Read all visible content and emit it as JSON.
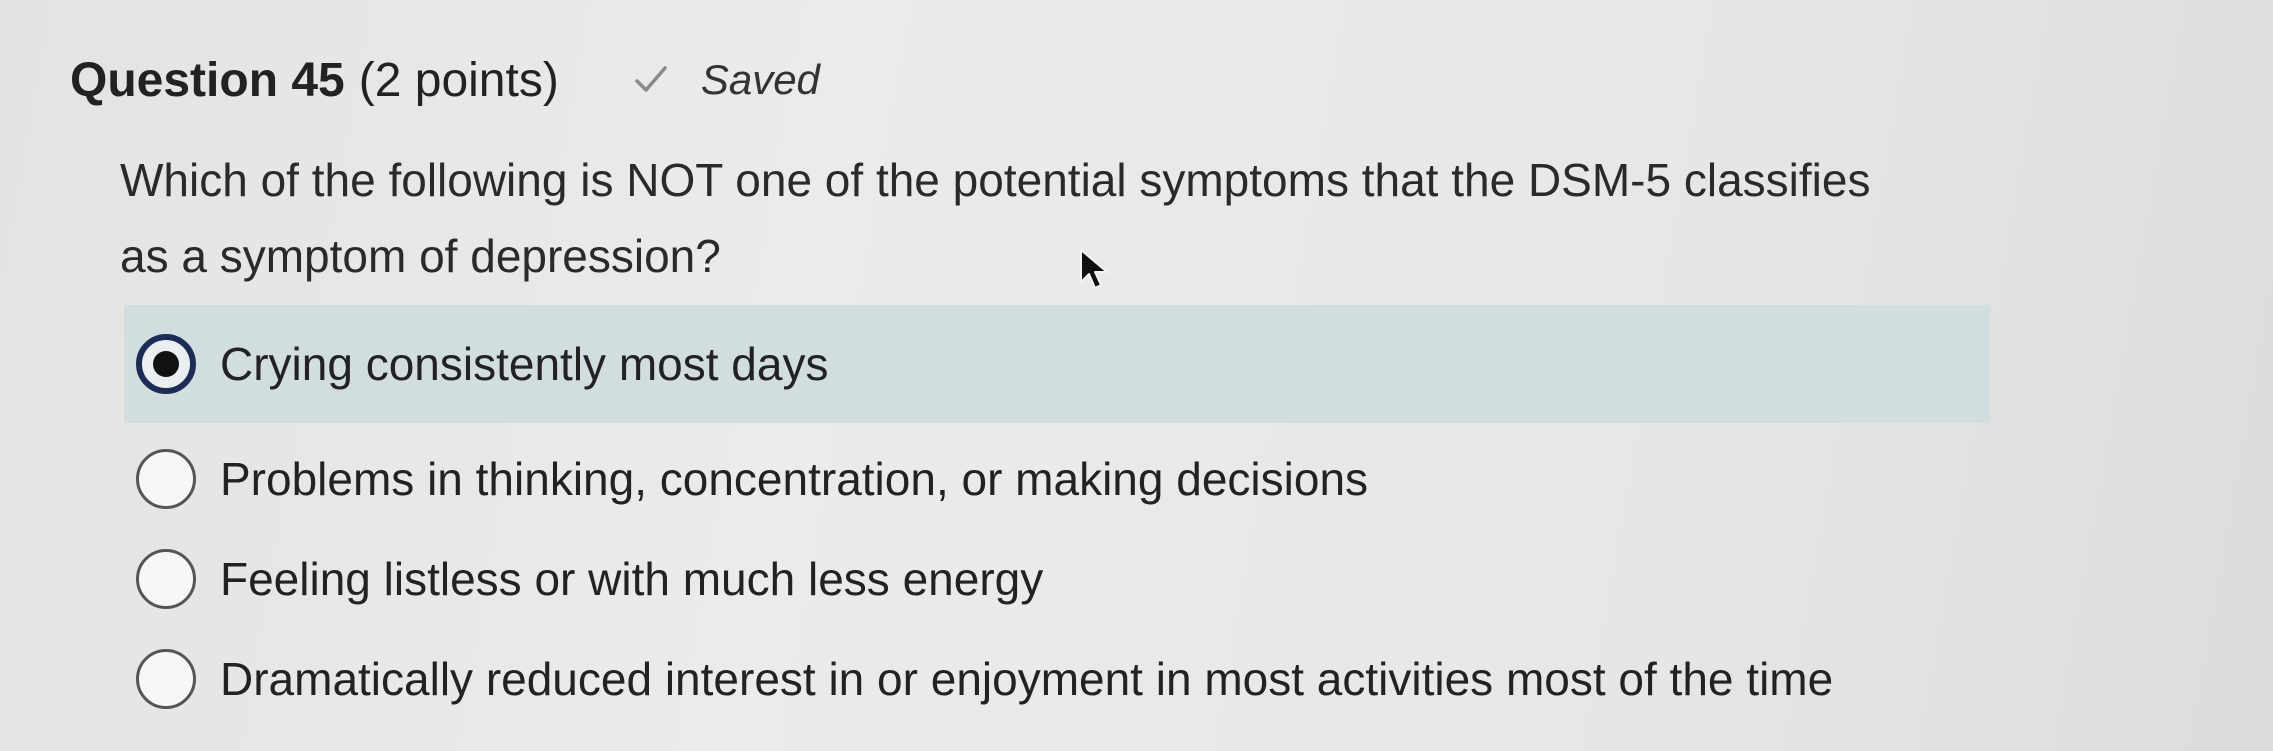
{
  "question": {
    "title": "Question 45",
    "points": "(2 points)",
    "status": "Saved",
    "prompt": "Which of the following is NOT one of the potential symptoms that the DSM-5 classifies as a symptom of depression?"
  },
  "options": [
    {
      "label": "Crying consistently most days",
      "selected": true
    },
    {
      "label": "Problems in thinking, concentration, or making decisions",
      "selected": false
    },
    {
      "label": "Feeling listless or with much less energy",
      "selected": false
    },
    {
      "label": "Dramatically reduced interest in or enjoyment in most activities most of the time",
      "selected": false
    }
  ],
  "icons": {
    "status": "checkmark-icon",
    "pointer": "mouse-cursor-icon"
  },
  "colors": {
    "selected_row": "#d2dde0",
    "radio_selected_ring": "#1b2c55"
  }
}
